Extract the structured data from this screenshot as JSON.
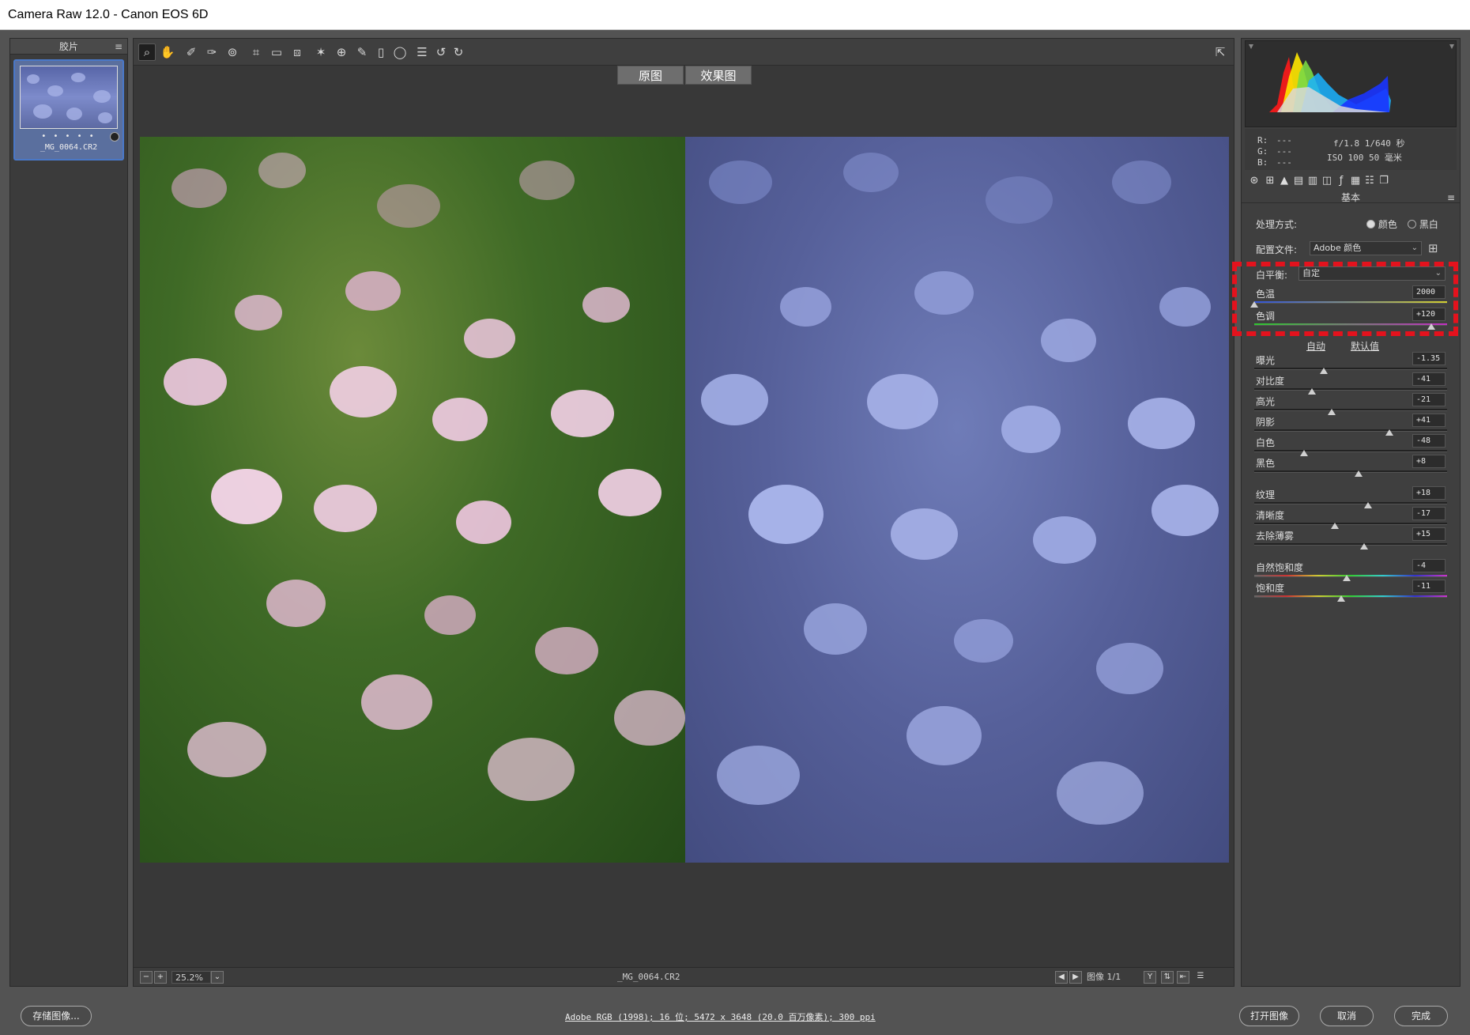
{
  "window": {
    "title": "Camera Raw 12.0 -  Canon EOS 6D"
  },
  "filmstrip": {
    "header": "胶片",
    "thumbnail": {
      "filename": "_MG_0064.CR2",
      "rating_dots": "• • • • •"
    }
  },
  "toolbar": {
    "tools": [
      "zoom-icon",
      "hand-icon",
      "white-balance-icon",
      "color-sampler-icon",
      "target-adjust-icon",
      "crop-icon",
      "straighten-icon",
      "transform-icon",
      "spot-removal-icon",
      "red-eye-icon",
      "adjustment-brush-icon",
      "graduated-filter-icon",
      "radial-filter-icon",
      "presets-list-icon",
      "rotate-left-icon",
      "rotate-right-icon"
    ]
  },
  "view_tabs": {
    "before": "原图",
    "after": "效果图"
  },
  "statusbar": {
    "zoom": "25.2%",
    "filename": "_MG_0064.CR2",
    "image_count": "图像 1/1"
  },
  "info": {
    "r_label": "R:",
    "g_label": "G:",
    "b_label": "B:",
    "r_val": "---",
    "g_val": "---",
    "b_val": "---",
    "aperture_shutter": "f/1.8   1/640 秒",
    "iso_focal": "ISO 100   50 毫米"
  },
  "basic": {
    "section_title": "基本",
    "treatment_label": "处理方式:",
    "treatment_color": "颜色",
    "treatment_bw": "黑白",
    "profile_label": "配置文件:",
    "profile_value": "Adobe 颜色",
    "wb_label": "白平衡:",
    "wb_value": "自定",
    "auto_link": "自动",
    "default_link": "默认值",
    "sliders": [
      {
        "label": "色温",
        "value": "2000",
        "pos": 0.0
      },
      {
        "label": "色调",
        "value": "+120",
        "pos": 0.9
      },
      {
        "label": "曝光",
        "value": "-1.35",
        "pos": 0.36
      },
      {
        "label": "对比度",
        "value": "-41",
        "pos": 0.3
      },
      {
        "label": "高光",
        "value": "-21",
        "pos": 0.4
      },
      {
        "label": "阴影",
        "value": "+41",
        "pos": 0.7
      },
      {
        "label": "白色",
        "value": "-48",
        "pos": 0.26
      },
      {
        "label": "黑色",
        "value": "+8",
        "pos": 0.54
      },
      {
        "label": "纹理",
        "value": "+18",
        "pos": 0.59
      },
      {
        "label": "清晰度",
        "value": "-17",
        "pos": 0.42
      },
      {
        "label": "去除薄雾",
        "value": "+15",
        "pos": 0.57
      },
      {
        "label": "自然饱和度",
        "value": "-4",
        "pos": 0.48
      },
      {
        "label": "饱和度",
        "value": "-11",
        "pos": 0.45
      }
    ]
  },
  "bottom": {
    "save_button": "存储图像...",
    "info_link": "Adobe RGB (1998); 16 位; 5472 x 3648 (20.0 百万像素); 300 ppi",
    "open_button": "打开图像",
    "cancel_button": "取消",
    "done_button": "完成"
  },
  "colors": {
    "accent": "#4a78c8",
    "highlight_box": "#e4121d"
  }
}
